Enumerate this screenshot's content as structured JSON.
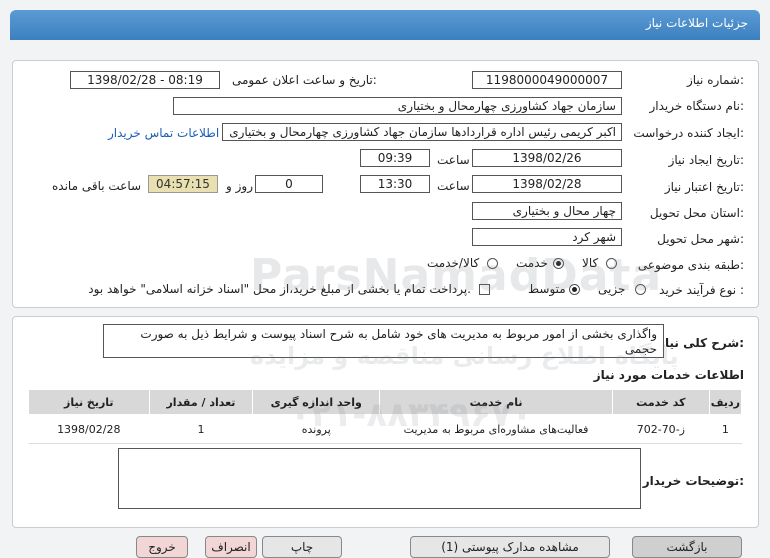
{
  "header": {
    "title": "جزئیات اطلاعات نیاز"
  },
  "form": {
    "need_number_label": "شماره نیاز:",
    "need_number": "1198000049000007",
    "announce_label": "تاریخ و ساعت اعلان عمومی:",
    "announce_value": "1398/02/28 - 08:19",
    "buyer_label": "نام دستگاه خریدار:",
    "buyer_value": "سازمان جهاد کشاورزی چهارمحال و بختیاری",
    "requester_label": "ایجاد کننده درخواست:",
    "requester_value": "اکبر کریمی رئیس اداره قراردادها سازمان جهاد کشاورزی چهارمحال و بختیاری",
    "contact_link": "اطلاعات تماس خریدار",
    "created_date_label": "تاریخ ایجاد نیاز:",
    "created_date": "1398/02/26",
    "time_label": "ساعت",
    "created_time": "09:39",
    "valid_label": "تاریخ اعتبار نیاز:",
    "valid_date": "1398/02/28",
    "valid_time": "13:30",
    "days_label": "روز و",
    "days_value": "0",
    "remaining_value": "04:57:15",
    "remaining_label": "ساعت باقی مانده",
    "province_label": "استان محل تحویل:",
    "province_value": "چهار محال و بختیاری",
    "city_label": "شهر محل تحویل:",
    "city_value": "شهر کرد",
    "category_label": "طبقه بندی موضوعی:",
    "category_options": [
      "کالا",
      "خدمت",
      "کالا/خدمت"
    ],
    "category_selected": "خدمت",
    "process_label": "نوع فرآیند خرید :",
    "process_options": [
      "جزیی",
      "متوسط"
    ],
    "process_selected": "متوسط",
    "payment_note": "پرداخت تمام یا بخشی از مبلغ خرید،از محل \"اسناد خزانه اسلامی\" خواهد بود."
  },
  "summary": {
    "label": "شرح کلی نیاز:",
    "text_line1": "واگذاری بخشی از امور مربوط به مدیریت های  خود شامل به شرح اسناد پیوست و شرایط ذیل به صورت",
    "text_line2": "حجمی"
  },
  "services": {
    "title": "اطلاعات خدمات مورد نیاز",
    "headers": [
      "ردیف",
      "کد خدمت",
      "نام خدمت",
      "واحد اندازه گیری",
      "تعداد / مقدار",
      "تاریخ نیاز"
    ],
    "rows": [
      [
        "1",
        "ز-70-702",
        "فعالیت‌های مشاوره‌ای مربوط به مدیریت",
        "پرونده",
        "1",
        "1398/02/28"
      ]
    ]
  },
  "buyer_notes": {
    "label": "توضیحات خریدار:",
    "value": ""
  },
  "footer_buttons": [
    "بازگشت",
    "مشاهده مدارک پیوستی (1)",
    "چاپ",
    "انصراف",
    "خروج"
  ],
  "watermark": {
    "logo_text": "ParsNamadData",
    "sub_text": "پایگاه اطلاع رسانی مناقصه و مزایده",
    "phone": "۰۲۱-۸۸۳۴۹۶۷۰"
  },
  "colors": {
    "header": "#3d80c0",
    "link": "#1a5fb4",
    "remaining_bg": "#e8e0b0"
  }
}
